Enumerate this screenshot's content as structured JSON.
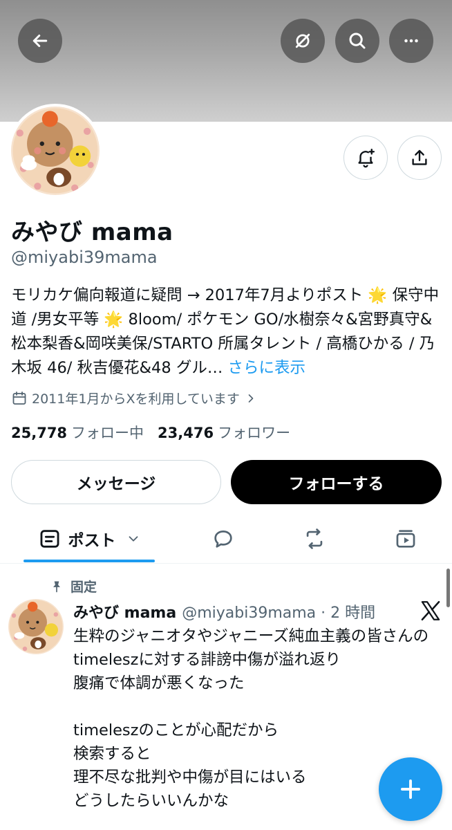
{
  "header": {
    "back_icon": "arrow-left-icon",
    "grok_icon": "slash-circle-icon",
    "search_icon": "search-icon",
    "more_icon": "more-horizontal-icon"
  },
  "profile": {
    "name": "みやび mama",
    "handle": "@miyabi39mama",
    "bio_text": "モリカケ偏向報道に疑問 → 2017年7月よりポスト 🌟 保守中道 /男女平等 🌟 8loom/ ポケモン GO/水樹奈々&宮野真守&松本梨香&岡咲美保/STARTO 所属タレント / 高橋ひかる / 乃木坂 46/ 秋吉優花&48 グル… ",
    "bio_more": "さらに表示",
    "joined": "2011年1月からXを利用しています",
    "following_count": "25,778",
    "following_label": "フォロー中",
    "followers_count": "23,476",
    "followers_label": "フォロワー"
  },
  "actions": {
    "message_label": "メッセージ",
    "follow_label": "フォローする"
  },
  "tabs": {
    "posts_label": "ポスト"
  },
  "post": {
    "pinned_label": "固定",
    "author_name": "みやび mama",
    "meta": "@miyabi39mama · 2 時間",
    "body": "生粋のジャニオタやジャニーズ純血主義の皆さんの\ntimeleszに対する誹謗中傷が溢れ返り\n腹痛で体調が悪くなった\n\ntimeleszのことが心配だから\n検索すると\n理不尽な批判や中傷が目にはいる\nどうしたらいいんかな"
  },
  "colors": {
    "accent": "#1d9bf0",
    "text": "#0f1419",
    "muted": "#536471",
    "follow_bg": "#000000"
  }
}
